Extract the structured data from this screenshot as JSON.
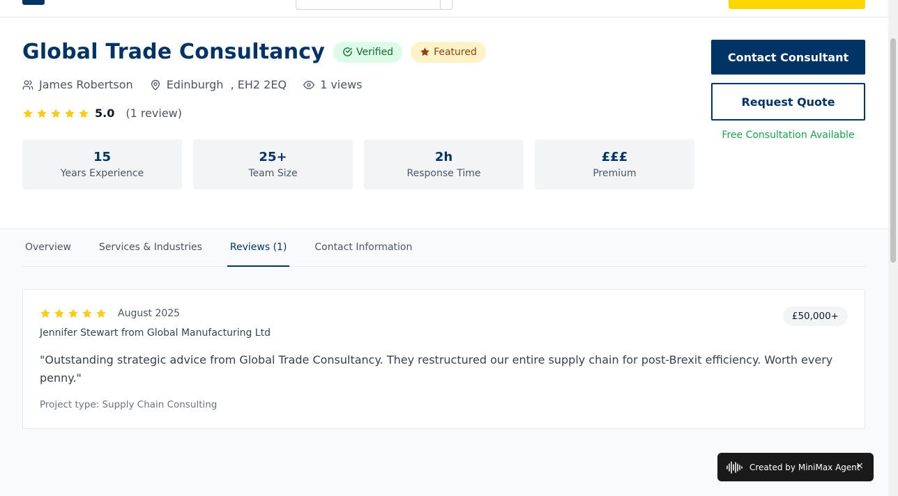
{
  "consultant": {
    "name": "Global Trade Consultancy",
    "badges": {
      "verified": "Verified",
      "featured": "Featured"
    },
    "contact_person": "James Robertson",
    "location": "Edinburgh  , EH2 2EQ",
    "views": "1 views",
    "rating": "5.0",
    "review_count": "(1 review)",
    "star_count": 5
  },
  "stats": [
    {
      "value": "15",
      "label": "Years Experience"
    },
    {
      "value": "25+",
      "label": "Team Size"
    },
    {
      "value": "2h",
      "label": "Response Time"
    },
    {
      "value": "£££",
      "label": "Premium"
    }
  ],
  "actions": {
    "contact": "Contact Consultant",
    "quote": "Request Quote",
    "free_consultation": "Free Consultation Available"
  },
  "tabs": [
    {
      "label": "Overview",
      "active": false
    },
    {
      "label": "Services & Industries",
      "active": false
    },
    {
      "label": "Reviews (1)",
      "active": true
    },
    {
      "label": "Contact Information",
      "active": false
    }
  ],
  "review": {
    "stars": 5,
    "date": "August 2025",
    "author": "Jennifer Stewart from Global Manufacturing Ltd",
    "text": "\"Outstanding strategic advice from Global Trade Consultancy. They restructured our entire supply chain for post-Brexit efficiency. Worth every penny.\"",
    "project_type": "Project type: Supply Chain Consulting",
    "budget": "£50,000+"
  },
  "footer_badge": {
    "text": "Created by MiniMax Agent",
    "close": "×"
  },
  "colors": {
    "primary": "#003366",
    "accent": "#ffd700",
    "star": "#facc15",
    "success": "#16a34a"
  }
}
